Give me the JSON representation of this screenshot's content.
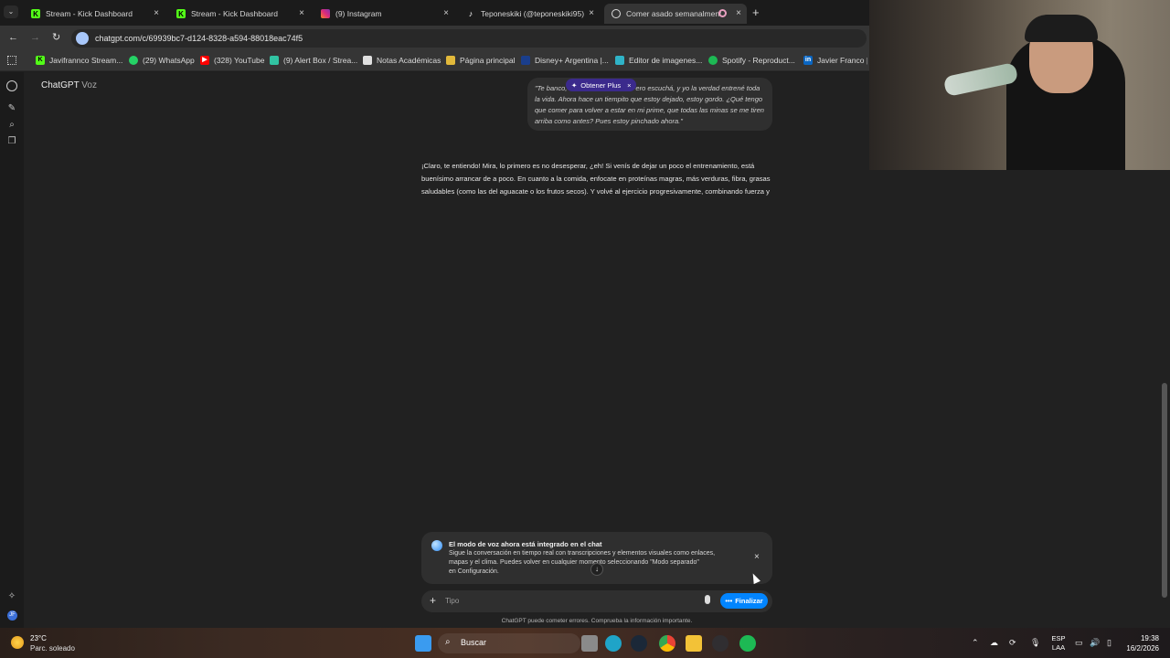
{
  "tabs": [
    {
      "title": "Stream - Kick Dashboard",
      "icon": "kick-icon"
    },
    {
      "title": "Stream - Kick Dashboard",
      "icon": "kick-icon"
    },
    {
      "title": "(9) Instagram",
      "icon": "instagram-icon"
    },
    {
      "title": "Teponeskiki (@teponeskiki95) |",
      "icon": "tiktok-icon"
    },
    {
      "title": "Comer asado semanalment",
      "icon": "chatgpt-icon"
    }
  ],
  "address": {
    "url": "chatgpt.com/c/69939bc7-d124-8328-a594-88018eac74f5"
  },
  "bookmarks": [
    {
      "label": "Javifrannco Stream...",
      "color": "#53fc18"
    },
    {
      "label": "(29) WhatsApp",
      "color": "#25d366"
    },
    {
      "label": "(328) YouTube",
      "color": "#ff0000"
    },
    {
      "label": "(9) Alert Box / Strea...",
      "color": "#31c3a2"
    },
    {
      "label": "Notas Académicas",
      "color": "#e0e0e0"
    },
    {
      "label": "Página principal",
      "color": "#e2b93b"
    },
    {
      "label": "Disney+ Argentina |...",
      "color": "#1a3e8c"
    },
    {
      "label": "Editor de imagenes...",
      "color": "#2fb3c7"
    },
    {
      "label": "Spotify - Reproduct...",
      "color": "#1db954"
    },
    {
      "label": "Javier Franco | Li",
      "color": "#0a66c2"
    }
  ],
  "header": {
    "title": "ChatGPT",
    "subtitle": "Voz"
  },
  "plus_pill": {
    "label": "Obtener Plus",
    "close": "×"
  },
  "user_message": {
    "start": "\"Te banco,",
    "rest": " Pero escuchá, y yo la verdad entrené toda la vida. Ahora hace un tiempito que estoy dejado, estoy gordo. ¿Qué tengo que comer para volver a estar en mi prime, que todas las minas se me tiren arriba como antes? Pues estoy pinchado ahora.\""
  },
  "assistant_message": "¡Claro, te entiendo! Mira, lo primero es no desesperar, ¿eh! Si venís de dejar un poco el entrenamiento, está buenísimo arrancar de a poco. En cuanto a la comida, enfocate en proteínas magras, más verduras, fibra, grasas saludables (como las del aguacate o los frutos secos). Y volvé al ejercicio progresivamente, combinando fuerza y",
  "voice_notice": {
    "title": "El modo de voz ahora está integrado en el chat",
    "line1": "Sigue la conversación en tiempo real con transcripciones y elementos visuales como enlaces,",
    "line2": "mapas y el clima. Puedes volver en cualquier momento seleccionando \"Modo separado\"",
    "line3": "en Configuración."
  },
  "composer": {
    "placeholder": "Tipo",
    "finish_label": "Finalizar"
  },
  "disclaimer": "ChatGPT puede cometer errores. Comprueba la información importante.",
  "taskbar": {
    "weather_temp": "23°C",
    "weather_desc": "Parc. soleado",
    "search_label": "Buscar",
    "lang_top": "ESP",
    "lang_bottom": "LAA",
    "time": "19:38",
    "date": "16/2/2026"
  },
  "colors": {
    "accent": "#0285ff",
    "plus": "#3b2a8c",
    "bg": "#212121"
  }
}
